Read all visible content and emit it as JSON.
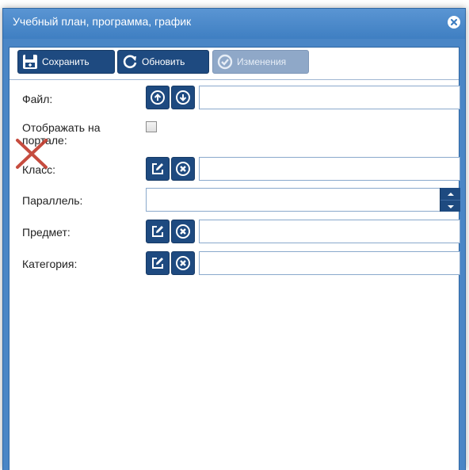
{
  "window": {
    "title": "Учебный план, программа, график"
  },
  "toolbar": {
    "save_label": "Сохранить",
    "refresh_label": "Обновить",
    "changes_label": "Изменения"
  },
  "form": {
    "file_label": "Файл:",
    "show_on_portal_label": "Отображать на портале:",
    "class_label": "Класс:",
    "parallel_label": "Параллель:",
    "subject_label": "Предмет:",
    "category_label": "Категория:"
  },
  "values": {
    "file": "",
    "show_on_portal": false,
    "class": "",
    "parallel": "",
    "subject": "",
    "category": ""
  },
  "colors": {
    "titlebar": "#4a86c6",
    "button": "#1e4a80",
    "button_disabled": "#8fa8c8",
    "annotation_x": "#c0392b"
  },
  "icons": {
    "close": "close-circle-icon",
    "save": "save-icon",
    "refresh": "refresh-icon",
    "changes": "history-icon",
    "upload": "upload-icon",
    "download": "download-icon",
    "edit": "edit-icon",
    "clear": "clear-icon",
    "spin_up": "chevron-up-icon",
    "spin_down": "chevron-down-icon"
  }
}
